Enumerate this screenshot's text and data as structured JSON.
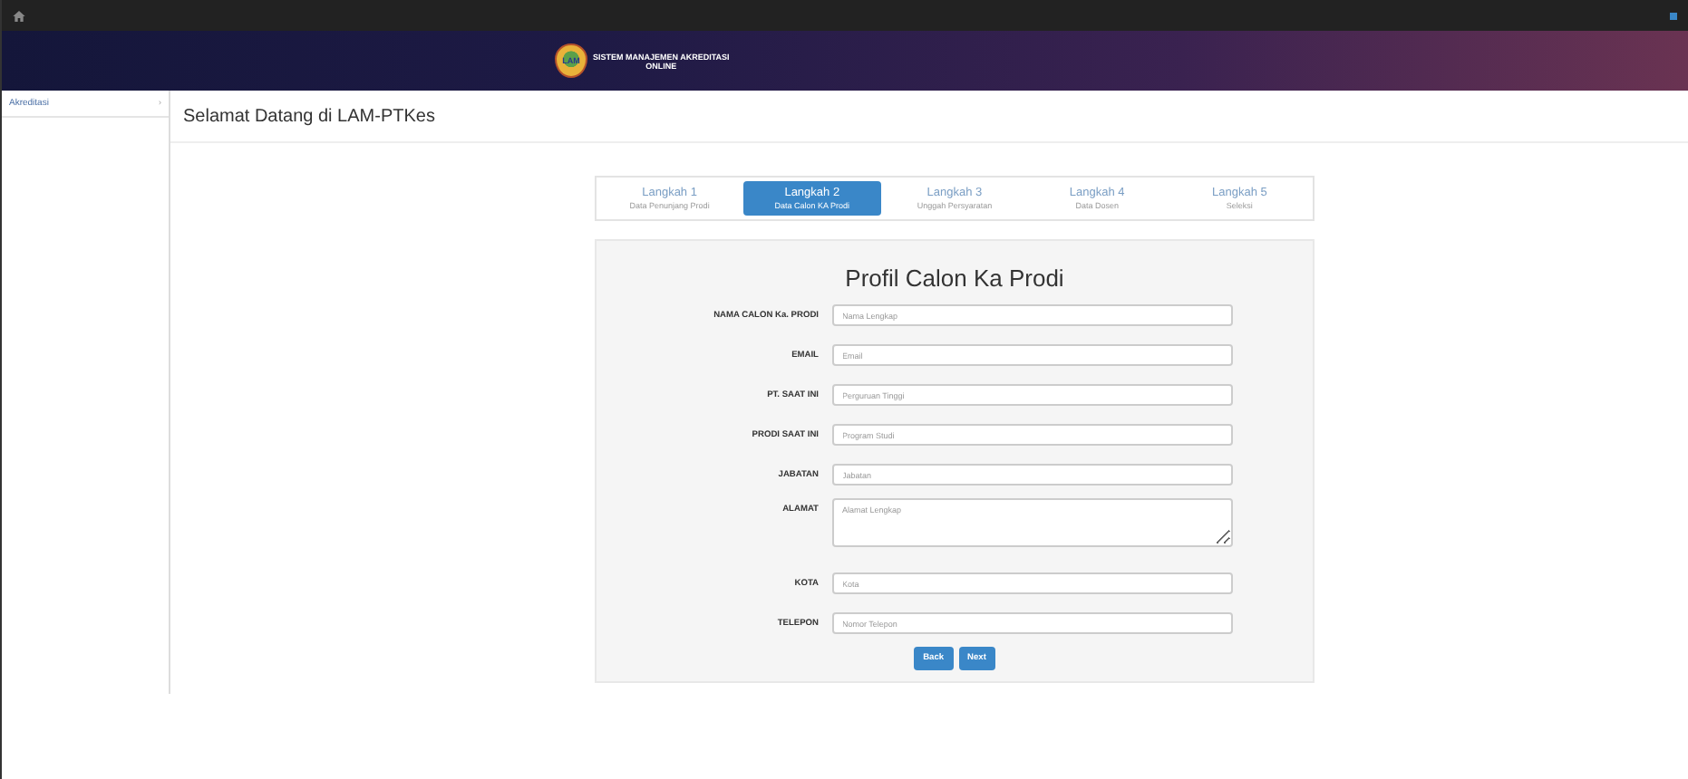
{
  "banner": {
    "title": "SISTEM MANAJEMEN AKREDITASI",
    "subtitle": "ONLINE",
    "logo_text": "LAM"
  },
  "sidebar": {
    "items": [
      {
        "label": "Akreditasi",
        "chevron": "›"
      }
    ]
  },
  "page_title": "Selamat Datang di LAM-PTKes",
  "steps": [
    {
      "title": "Langkah 1",
      "subtitle": "Data Penunjang Prodi",
      "selected": false
    },
    {
      "title": "Langkah 2",
      "subtitle": "Data Calon KA Prodi",
      "selected": true
    },
    {
      "title": "Langkah 3",
      "subtitle": "Unggah Persyaratan",
      "selected": false
    },
    {
      "title": "Langkah 4",
      "subtitle": "Data Dosen",
      "selected": false
    },
    {
      "title": "Langkah 5",
      "subtitle": "Seleksi",
      "selected": false
    }
  ],
  "form": {
    "title": "Profil Calon Ka Prodi",
    "fields": [
      {
        "label": "NAMA CALON Ka. PRODI",
        "placeholder": "Nama Lengkap",
        "kind": "text"
      },
      {
        "label": "EMAIL",
        "placeholder": "Email",
        "kind": "text"
      },
      {
        "label": "PT. SAAT INI",
        "placeholder": "Perguruan Tinggi",
        "kind": "text"
      },
      {
        "label": "PRODI SAAT INI",
        "placeholder": "Program Studi",
        "kind": "text"
      },
      {
        "label": "JABATAN",
        "placeholder": "Jabatan",
        "kind": "text"
      },
      {
        "label": "ALAMAT",
        "placeholder": "Alamat Lengkap",
        "kind": "textarea"
      },
      {
        "label": "KOTA",
        "placeholder": "Kota",
        "kind": "text"
      },
      {
        "label": "TELEPON",
        "placeholder": "Nomor Telepon",
        "kind": "text"
      }
    ],
    "buttons": [
      "Back",
      "Next"
    ]
  }
}
